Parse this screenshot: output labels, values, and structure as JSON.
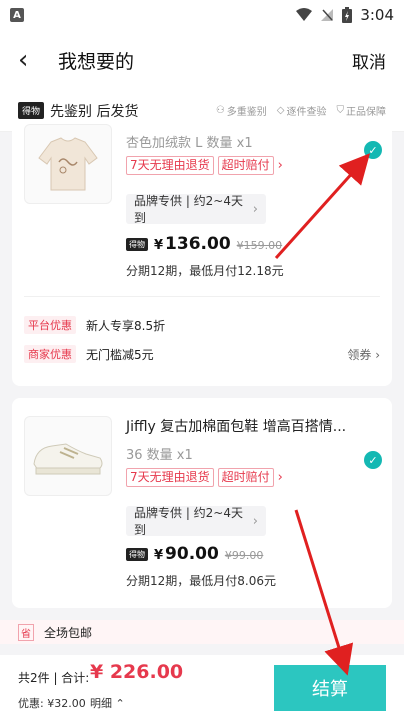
{
  "statusbar": {
    "time": "3:04",
    "app_badge": "A"
  },
  "header": {
    "title": "我想要的",
    "cancel": "取消"
  },
  "banner": {
    "logo": "得物",
    "slogan": "先鉴别 后发货",
    "features": [
      "多重鉴别",
      "逐件查验",
      "正品保障"
    ]
  },
  "items": [
    {
      "name": "",
      "spec": "杏色加绒款 L 数量 x1",
      "tags": [
        "7天无理由退货",
        "超时赔付"
      ],
      "delivery": "品牌专供 | 约2~4天到",
      "logo": "得物",
      "price": "136.00",
      "currency": "¥",
      "orig_price": "¥159.00",
      "installment": "分期12期，最低月付12.18元",
      "promos": [
        {
          "tag": "平台优惠",
          "text": "新人专享8.5折",
          "link": ""
        },
        {
          "tag": "商家优惠",
          "text": "无门槛减5元",
          "link": "领券"
        }
      ]
    },
    {
      "name": "Jiffly 复古加棉面包鞋 增高百搭情...",
      "spec": "36 数量 x1",
      "tags": [
        "7天无理由退货",
        "超时赔付"
      ],
      "delivery": "品牌专供 | 约2~4天到",
      "logo": "得物",
      "price": "90.00",
      "currency": "¥",
      "orig_price": "¥99.00"
    }
  ],
  "ship_banner": {
    "tag": "省",
    "text": "全场包邮"
  },
  "footer": {
    "count": "共2件 | 合计:",
    "total": "¥ 226.00",
    "discount": "优惠: ¥32.00",
    "detail": "明细",
    "checkout": "结算"
  },
  "colors": {
    "accent": "#2cc6c0",
    "price_red": "#e6394d",
    "arrow": "#e02020"
  }
}
